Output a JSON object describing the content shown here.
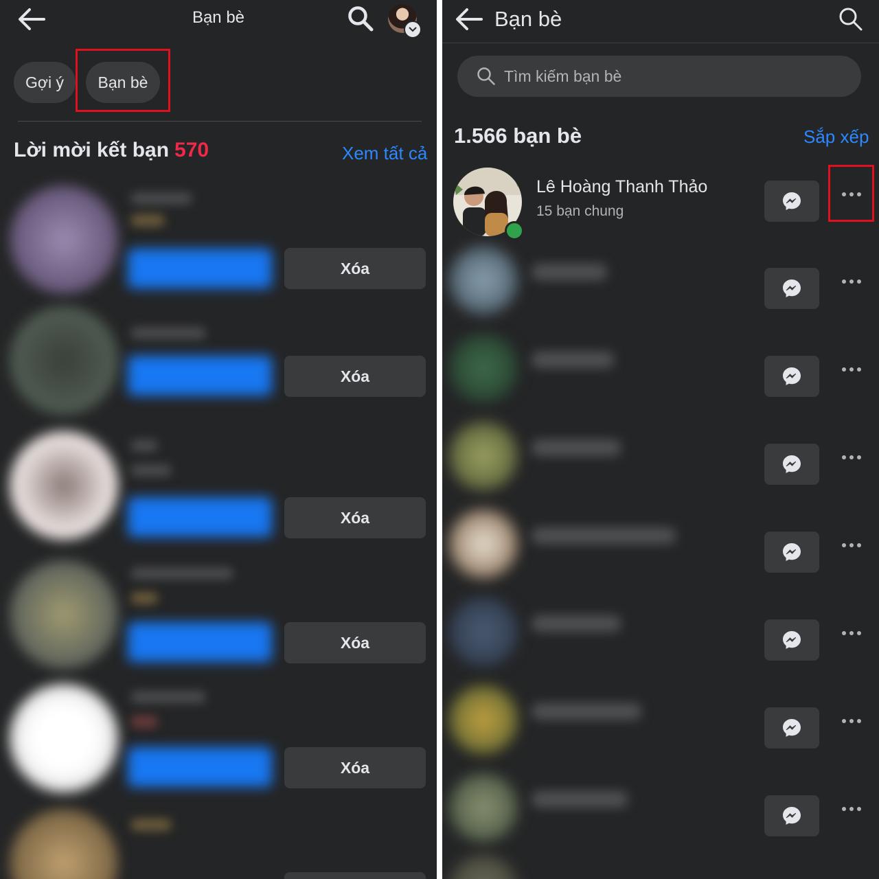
{
  "left": {
    "title": "Bạn bè",
    "tabs": [
      {
        "label": "Gợi ý"
      },
      {
        "label": "Bạn bè"
      }
    ],
    "requests_heading": "Lời mời kết bạn",
    "requests_count": "570",
    "see_all": "Xem tất cả",
    "requests": [
      {
        "delete_label": "Xóa"
      },
      {
        "delete_label": "Xóa"
      },
      {
        "delete_label": "Xóa"
      },
      {
        "delete_label": "Xóa"
      },
      {
        "delete_label": "Xóa"
      }
    ]
  },
  "right": {
    "title": "Bạn bè",
    "search_placeholder": "Tìm kiếm bạn bè",
    "friend_count": "1.566 bạn bè",
    "sort_label": "Sắp xếp",
    "friends": [
      {
        "name": "Lê Hoàng Thanh Thảo",
        "mutual": "15 bạn chung",
        "online": true
      }
    ]
  },
  "colors": {
    "background": "#242526",
    "accent": "#2d88ff",
    "count": "#f02849",
    "highlight": "#e0101e",
    "online": "#31a24c"
  },
  "icons": [
    "back-arrow-icon",
    "search-icon",
    "messenger-icon",
    "more-dots-icon"
  ]
}
